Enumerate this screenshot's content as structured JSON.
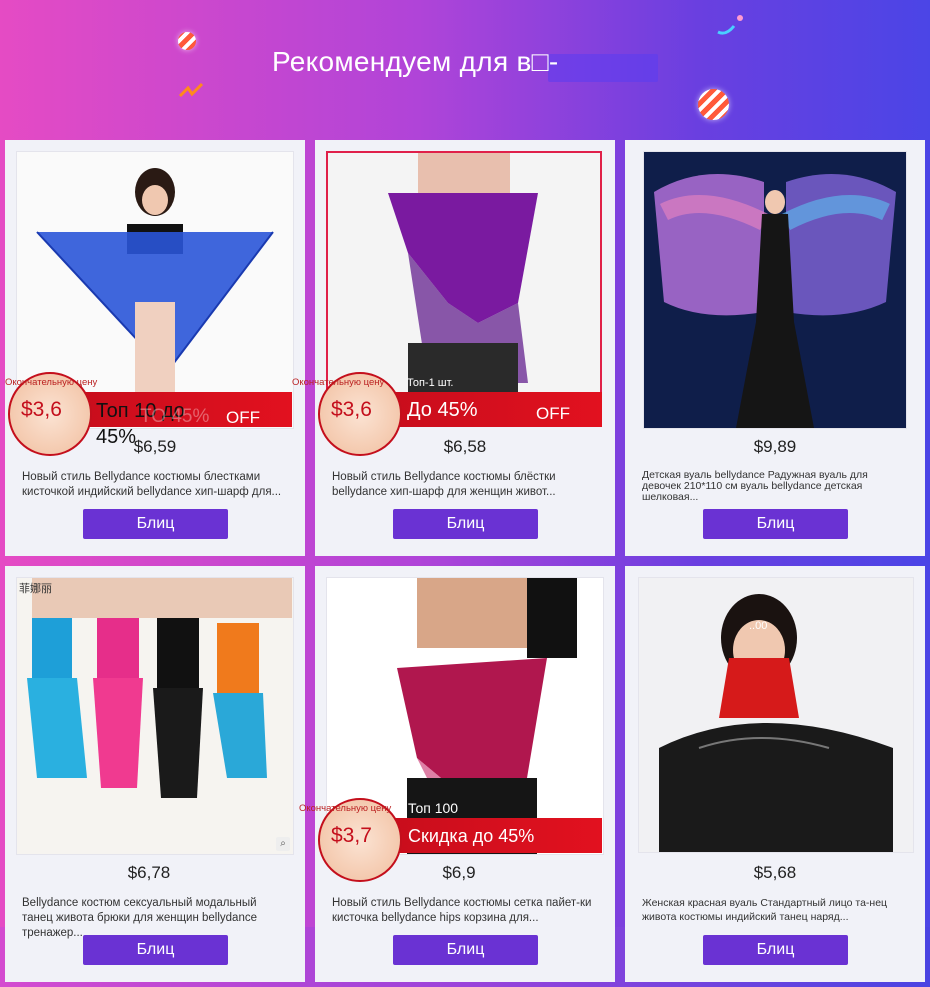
{
  "header": {
    "title": "Рекомендуем для в□-"
  },
  "products": [
    {
      "price": "$6,59",
      "description": "Новый стиль Bellydance костюмы блестками кисточкой индийский bellydance хип-шарф для...",
      "button": "Блиц",
      "promo": {
        "final_price_label": "Окончательную цену",
        "price": "$3,6",
        "headline": "Топ 10 до 45%",
        "headline_ghost": "TO 45%",
        "suffix": "OFF"
      }
    },
    {
      "price": "$6,58",
      "description": "Новый стиль Bellydance костюмы блёстки bellydance хип-шарф для женщин живот...",
      "button": "Блиц",
      "promo": {
        "final_price_label": "Окончательную цену",
        "price": "$3,6",
        "tag": "Топ-1 шт.",
        "headline": "До 45%",
        "suffix": "OFF"
      }
    },
    {
      "price": "$9,89",
      "description": "Детская вуаль bellydance Радужная вуаль для девочек 210*110 см вуаль bellydance детская шелковая...",
      "button": "Блиц"
    },
    {
      "price": "$6,78",
      "description": "Bellydance костюм сексуальный модальный танец живота брюки для женщин bellydance тренажер...",
      "button": "Блиц",
      "badge": "菲娜丽"
    },
    {
      "price": "$6,9",
      "description": "Новый стиль Bellydance костюмы сетка пайет-ки кисточка bellydance hips корзина для...",
      "button": "Блиц",
      "promo": {
        "final_price_label": "Окончательную цену",
        "price": "$3,7",
        "tag": "Топ 100",
        "headline": "Скидка до 45%"
      }
    },
    {
      "price": "$5,68",
      "description": "Женская красная вуаль Стандартный лицо та-нец живота костюмы индийский танец наряд...",
      "button": "Блиц",
      "image_text": "..00"
    }
  ],
  "colors": {
    "button": "#6a32d3",
    "promo_red": "#d4101e",
    "card_bg": "#f1f2f8"
  }
}
